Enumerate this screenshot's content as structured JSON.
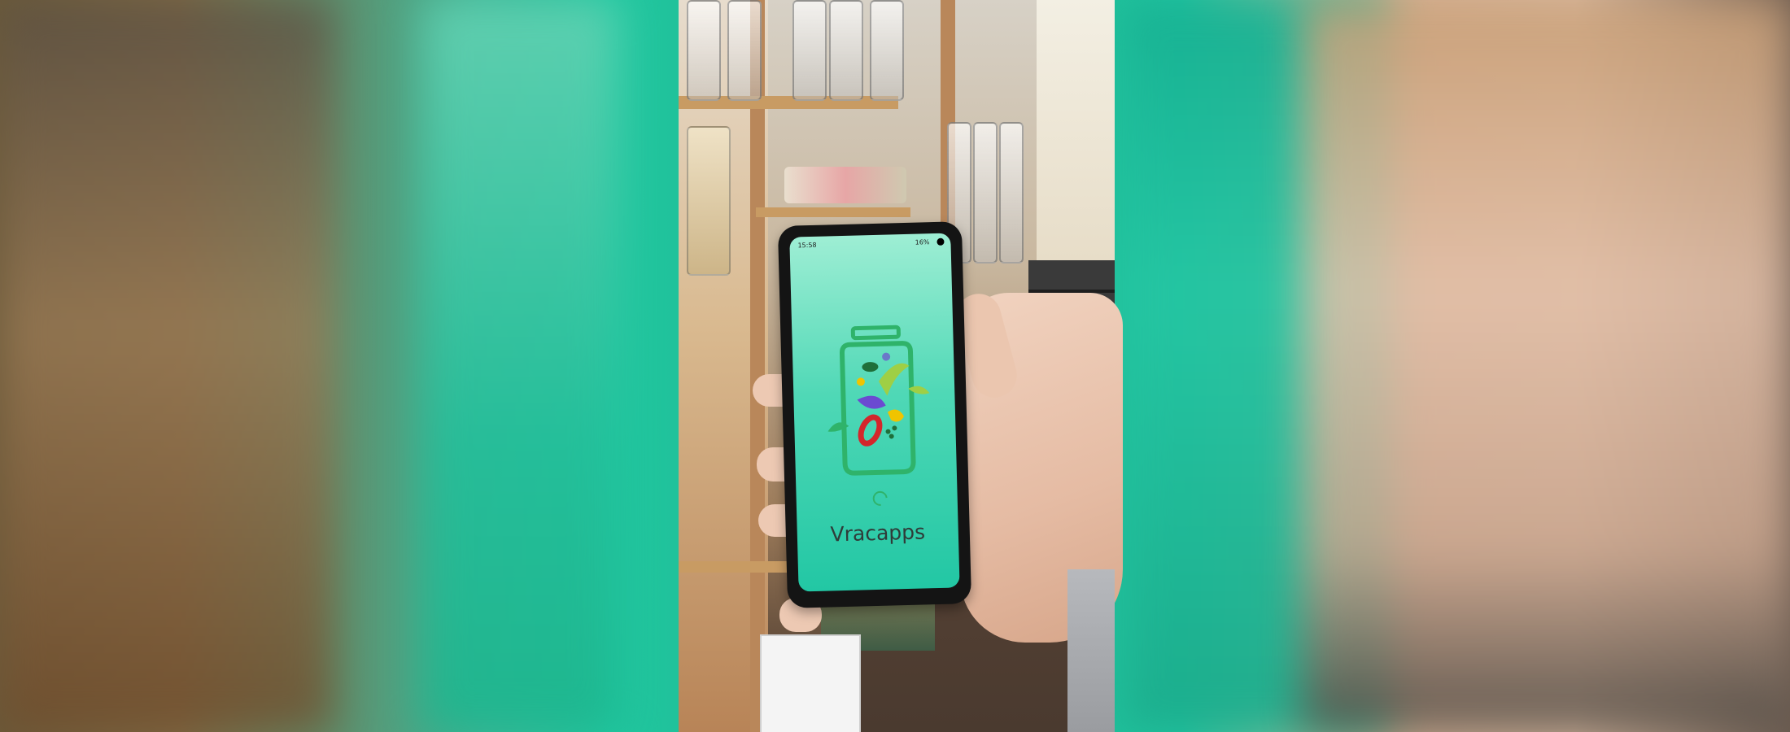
{
  "app": {
    "name": "Vracapps",
    "status_time": "15:58",
    "status_battery": "16%"
  },
  "icons": {
    "logo": "jar-with-vegetables-icon",
    "loading": "loading-spinner-icon"
  },
  "colors": {
    "screen_gradient_top": "#9eeed4",
    "screen_gradient_bottom": "#22c7a4",
    "logo_green": "#2fb36a"
  }
}
